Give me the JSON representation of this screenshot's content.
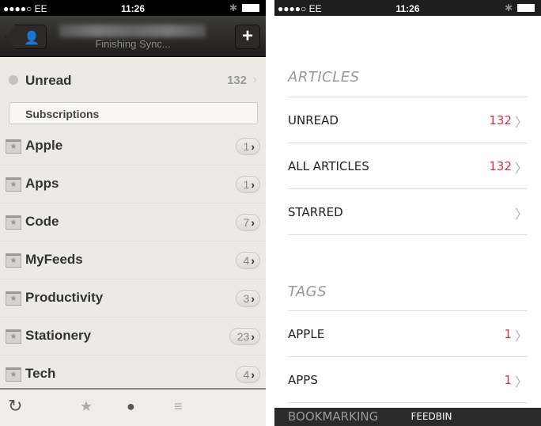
{
  "status": {
    "carrier": "●●●●○ EE",
    "time": "11:26",
    "bluetooth": "✱"
  },
  "left": {
    "sync_text": "Finishing Sync...",
    "unread": {
      "label": "Unread",
      "count": "132"
    },
    "subscriptions_label": "Subscriptions",
    "feeds": [
      {
        "label": "Apple",
        "count": "1"
      },
      {
        "label": "Apps",
        "count": "1"
      },
      {
        "label": "Code",
        "count": "7"
      },
      {
        "label": "MyFeeds",
        "count": "4"
      },
      {
        "label": "Productivity",
        "count": "3"
      },
      {
        "label": "Stationery",
        "count": "23"
      },
      {
        "label": "Tech",
        "count": "4"
      }
    ],
    "toolbar": {
      "refresh": "↻",
      "starred": "★",
      "unread": "●",
      "list": "≡"
    }
  },
  "right": {
    "articles_header": "ARTICLES",
    "articles": [
      {
        "label": "UNREAD",
        "count": "132"
      },
      {
        "label": "ALL ARTICLES",
        "count": "132"
      },
      {
        "label": "STARRED",
        "count": ""
      }
    ],
    "tags_header": "TAGS",
    "tags": [
      {
        "label": "APPLE",
        "count": "1"
      },
      {
        "label": "APPS",
        "count": "1"
      }
    ],
    "peek_label": "BOOKMARKING",
    "footer": "FEEDBIN",
    "accent": "#d0323a"
  }
}
